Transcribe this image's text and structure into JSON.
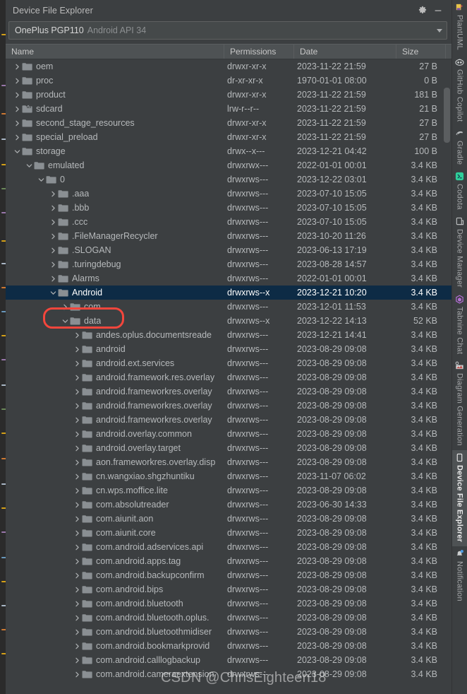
{
  "window": {
    "title": "Device File Explorer",
    "settings_icon": "gear-icon",
    "minimize_icon": "minimize-icon"
  },
  "device_selector": {
    "name": "OnePlus PGP110",
    "api": "Android API 34",
    "dropdown_icon": "chevron-down-icon"
  },
  "columns": [
    {
      "key": "name",
      "label": "Name"
    },
    {
      "key": "permissions",
      "label": "Permissions"
    },
    {
      "key": "date",
      "label": "Date"
    },
    {
      "key": "size",
      "label": "Size"
    }
  ],
  "rows": [
    {
      "name": "oem",
      "depth": 0,
      "state": "collapsed",
      "icon": "folder-icon",
      "permissions": "drwxr-xr-x",
      "date": "2023-11-22 21:59",
      "size": "27 B",
      "selected": false
    },
    {
      "name": "proc",
      "depth": 0,
      "state": "collapsed",
      "icon": "folder-icon",
      "permissions": "dr-xr-xr-x",
      "date": "1970-01-01 08:00",
      "size": "0 B",
      "selected": false
    },
    {
      "name": "product",
      "depth": 0,
      "state": "collapsed",
      "icon": "folder-icon",
      "permissions": "drwxr-xr-x",
      "date": "2023-11-22 21:59",
      "size": "181 B",
      "selected": false
    },
    {
      "name": "sdcard",
      "depth": 0,
      "state": "collapsed",
      "icon": "folder-link-icon",
      "permissions": "lrw-r--r--",
      "date": "2023-11-22 21:59",
      "size": "21 B",
      "selected": false
    },
    {
      "name": "second_stage_resources",
      "depth": 0,
      "state": "collapsed",
      "icon": "folder-icon",
      "permissions": "drwxr-xr-x",
      "date": "2023-11-22 21:59",
      "size": "27 B",
      "selected": false
    },
    {
      "name": "special_preload",
      "depth": 0,
      "state": "collapsed",
      "icon": "folder-icon",
      "permissions": "drwxr-xr-x",
      "date": "2023-11-22 21:59",
      "size": "27 B",
      "selected": false
    },
    {
      "name": "storage",
      "depth": 0,
      "state": "expanded",
      "icon": "folder-icon",
      "permissions": "drwx--x---",
      "date": "2023-12-21 04:42",
      "size": "100 B",
      "selected": false
    },
    {
      "name": "emulated",
      "depth": 1,
      "state": "expanded",
      "icon": "folder-icon",
      "permissions": "drwxrwx---",
      "date": "2022-01-01 00:01",
      "size": "3.4 KB",
      "selected": false
    },
    {
      "name": "0",
      "depth": 2,
      "state": "expanded",
      "icon": "folder-icon",
      "permissions": "drwxrws---",
      "date": "2023-12-22 03:01",
      "size": "3.4 KB",
      "selected": false
    },
    {
      "name": ".aaa",
      "depth": 3,
      "state": "collapsed",
      "icon": "folder-icon",
      "permissions": "drwxrws---",
      "date": "2023-07-10 15:05",
      "size": "3.4 KB",
      "selected": false
    },
    {
      "name": ".bbb",
      "depth": 3,
      "state": "collapsed",
      "icon": "folder-icon",
      "permissions": "drwxrws---",
      "date": "2023-07-10 15:05",
      "size": "3.4 KB",
      "selected": false
    },
    {
      "name": ".ccc",
      "depth": 3,
      "state": "collapsed",
      "icon": "folder-icon",
      "permissions": "drwxrws---",
      "date": "2023-07-10 15:05",
      "size": "3.4 KB",
      "selected": false
    },
    {
      "name": ".FileManagerRecycler",
      "depth": 3,
      "state": "collapsed",
      "icon": "folder-icon",
      "permissions": "drwxrws---",
      "date": "2023-10-20 11:26",
      "size": "3.4 KB",
      "selected": false
    },
    {
      "name": ".SLOGAN",
      "depth": 3,
      "state": "collapsed",
      "icon": "folder-icon",
      "permissions": "drwxrws---",
      "date": "2023-06-13 17:19",
      "size": "3.4 KB",
      "selected": false
    },
    {
      "name": ".turingdebug",
      "depth": 3,
      "state": "collapsed",
      "icon": "folder-icon",
      "permissions": "drwxrws---",
      "date": "2023-08-28 14:57",
      "size": "3.4 KB",
      "selected": false
    },
    {
      "name": "Alarms",
      "depth": 3,
      "state": "collapsed",
      "icon": "folder-icon",
      "permissions": "drwxrws---",
      "date": "2022-01-01 00:01",
      "size": "3.4 KB",
      "selected": false
    },
    {
      "name": "Android",
      "depth": 3,
      "state": "expanded",
      "icon": "folder-icon",
      "permissions": "drwxrws--x",
      "date": "2023-12-21 10:20",
      "size": "3.4 KB",
      "selected": true
    },
    {
      "name": "com",
      "depth": 4,
      "state": "collapsed",
      "icon": "folder-icon",
      "permissions": "drwxrws---",
      "date": "2023-12-01 11:53",
      "size": "3.4 KB",
      "selected": false
    },
    {
      "name": "data",
      "depth": 4,
      "state": "expanded",
      "icon": "folder-icon",
      "permissions": "drwxrws--x",
      "date": "2023-12-22 14:13",
      "size": "52 KB",
      "selected": false
    },
    {
      "name": "andes.oplus.documentsreade",
      "depth": 5,
      "state": "collapsed",
      "icon": "folder-icon",
      "permissions": "drwxrws---",
      "date": "2023-12-21 14:41",
      "size": "3.4 KB",
      "selected": false
    },
    {
      "name": "android",
      "depth": 5,
      "state": "collapsed",
      "icon": "folder-icon",
      "permissions": "drwxrws---",
      "date": "2023-08-29 09:08",
      "size": "3.4 KB",
      "selected": false
    },
    {
      "name": "android.ext.services",
      "depth": 5,
      "state": "collapsed",
      "icon": "folder-icon",
      "permissions": "drwxrws---",
      "date": "2023-08-29 09:08",
      "size": "3.4 KB",
      "selected": false
    },
    {
      "name": "android.framework.res.overlay",
      "depth": 5,
      "state": "collapsed",
      "icon": "folder-icon",
      "permissions": "drwxrws---",
      "date": "2023-08-29 09:08",
      "size": "3.4 KB",
      "selected": false
    },
    {
      "name": "android.frameworkres.overlay",
      "depth": 5,
      "state": "collapsed",
      "icon": "folder-icon",
      "permissions": "drwxrws---",
      "date": "2023-08-29 09:08",
      "size": "3.4 KB",
      "selected": false
    },
    {
      "name": "android.frameworkres.overlay",
      "depth": 5,
      "state": "collapsed",
      "icon": "folder-icon",
      "permissions": "drwxrws---",
      "date": "2023-08-29 09:08",
      "size": "3.4 KB",
      "selected": false
    },
    {
      "name": "android.frameworkres.overlay",
      "depth": 5,
      "state": "collapsed",
      "icon": "folder-icon",
      "permissions": "drwxrws---",
      "date": "2023-08-29 09:08",
      "size": "3.4 KB",
      "selected": false
    },
    {
      "name": "android.overlay.common",
      "depth": 5,
      "state": "collapsed",
      "icon": "folder-icon",
      "permissions": "drwxrws---",
      "date": "2023-08-29 09:08",
      "size": "3.4 KB",
      "selected": false
    },
    {
      "name": "android.overlay.target",
      "depth": 5,
      "state": "collapsed",
      "icon": "folder-icon",
      "permissions": "drwxrws---",
      "date": "2023-08-29 09:08",
      "size": "3.4 KB",
      "selected": false
    },
    {
      "name": "aon.frameworkres.overlay.disp",
      "depth": 5,
      "state": "collapsed",
      "icon": "folder-icon",
      "permissions": "drwxrws---",
      "date": "2023-08-29 09:08",
      "size": "3.4 KB",
      "selected": false
    },
    {
      "name": "cn.wangxiao.shgzhuntiku",
      "depth": 5,
      "state": "collapsed",
      "icon": "folder-icon",
      "permissions": "drwxrws---",
      "date": "2023-11-07 06:02",
      "size": "3.4 KB",
      "selected": false
    },
    {
      "name": "cn.wps.moffice.lite",
      "depth": 5,
      "state": "collapsed",
      "icon": "folder-icon",
      "permissions": "drwxrws---",
      "date": "2023-08-29 09:08",
      "size": "3.4 KB",
      "selected": false
    },
    {
      "name": "com.absolutreader",
      "depth": 5,
      "state": "collapsed",
      "icon": "folder-icon",
      "permissions": "drwxrws---",
      "date": "2023-06-30 14:33",
      "size": "3.4 KB",
      "selected": false
    },
    {
      "name": "com.aiunit.aon",
      "depth": 5,
      "state": "collapsed",
      "icon": "folder-icon",
      "permissions": "drwxrws---",
      "date": "2023-08-29 09:08",
      "size": "3.4 KB",
      "selected": false
    },
    {
      "name": "com.aiunit.core",
      "depth": 5,
      "state": "collapsed",
      "icon": "folder-icon",
      "permissions": "drwxrws---",
      "date": "2023-08-29 09:08",
      "size": "3.4 KB",
      "selected": false
    },
    {
      "name": "com.android.adservices.api",
      "depth": 5,
      "state": "collapsed",
      "icon": "folder-icon",
      "permissions": "drwxrws---",
      "date": "2023-08-29 09:08",
      "size": "3.4 KB",
      "selected": false
    },
    {
      "name": "com.android.apps.tag",
      "depth": 5,
      "state": "collapsed",
      "icon": "folder-icon",
      "permissions": "drwxrws---",
      "date": "2023-08-29 09:08",
      "size": "3.4 KB",
      "selected": false
    },
    {
      "name": "com.android.backupconfirm",
      "depth": 5,
      "state": "collapsed",
      "icon": "folder-icon",
      "permissions": "drwxrws---",
      "date": "2023-08-29 09:08",
      "size": "3.4 KB",
      "selected": false
    },
    {
      "name": "com.android.bips",
      "depth": 5,
      "state": "collapsed",
      "icon": "folder-icon",
      "permissions": "drwxrws---",
      "date": "2023-08-29 09:08",
      "size": "3.4 KB",
      "selected": false
    },
    {
      "name": "com.android.bluetooth",
      "depth": 5,
      "state": "collapsed",
      "icon": "folder-icon",
      "permissions": "drwxrws---",
      "date": "2023-08-29 09:08",
      "size": "3.4 KB",
      "selected": false
    },
    {
      "name": "com.android.bluetooth.oplus.",
      "depth": 5,
      "state": "collapsed",
      "icon": "folder-icon",
      "permissions": "drwxrws---",
      "date": "2023-08-29 09:08",
      "size": "3.4 KB",
      "selected": false
    },
    {
      "name": "com.android.bluetoothmidiser",
      "depth": 5,
      "state": "collapsed",
      "icon": "folder-icon",
      "permissions": "drwxrws---",
      "date": "2023-08-29 09:08",
      "size": "3.4 KB",
      "selected": false
    },
    {
      "name": "com.android.bookmarkprovid",
      "depth": 5,
      "state": "collapsed",
      "icon": "folder-icon",
      "permissions": "drwxrws---",
      "date": "2023-08-29 09:08",
      "size": "3.4 KB",
      "selected": false
    },
    {
      "name": "com.android.calllogbackup",
      "depth": 5,
      "state": "collapsed",
      "icon": "folder-icon",
      "permissions": "drwxrws---",
      "date": "2023-08-29 09:08",
      "size": "3.4 KB",
      "selected": false
    },
    {
      "name": "com.android.cameraextension",
      "depth": 5,
      "state": "collapsed",
      "icon": "folder-icon",
      "permissions": "drwxrws---",
      "date": "2023-08-29 09:08",
      "size": "3.4 KB",
      "selected": false
    }
  ],
  "annotation": {
    "target_row": "data",
    "color": "#f4463c"
  },
  "watermark": "CSDN @ChrisEighteen18",
  "tool_tabs": [
    {
      "label": "PlantUML",
      "icon": "plantuml-icon",
      "active": false
    },
    {
      "label": "GitHub Copilot",
      "icon": "github-copilot-icon",
      "active": false
    },
    {
      "label": "Gradle",
      "icon": "gradle-icon",
      "active": false
    },
    {
      "label": "Codota",
      "icon": "codota-icon",
      "active": false
    },
    {
      "label": "Device Manager",
      "icon": "device-manager-icon",
      "active": false
    },
    {
      "label": "Tabnine Chat",
      "icon": "tabnine-icon",
      "active": false
    },
    {
      "label": "Diagram Generation",
      "icon": "diagram-icon",
      "active": false
    },
    {
      "label": "Device File Explorer",
      "icon": "device-file-explorer-icon",
      "active": true
    },
    {
      "label": "Notification",
      "icon": "notification-icon",
      "active": false
    }
  ],
  "colors": {
    "panel_bg": "#3c3f41",
    "header_bg": "#4e5254",
    "selection": "#0d2b45",
    "text": "#b6b9bb",
    "accent_red": "#f4463c",
    "folder": "#8a8f93"
  }
}
